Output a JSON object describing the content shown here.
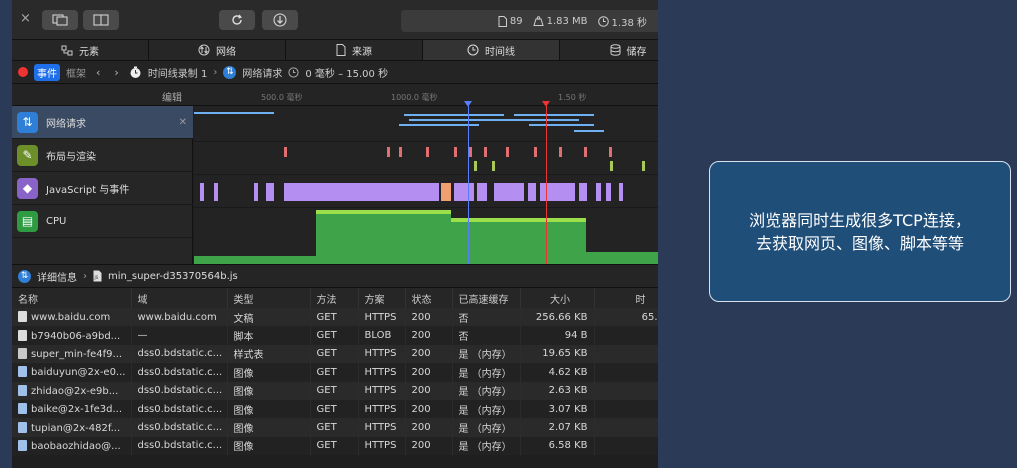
{
  "toolbar": {
    "close": "×",
    "status_resources": "89",
    "status_size": "1.83 MB",
    "status_time": "1.38 秒"
  },
  "tabs": [
    "元素",
    "网络",
    "来源",
    "时间线",
    "储存"
  ],
  "timeline_bar": {
    "events_label": "事件",
    "frames_label": "框架",
    "recording": "时间线录制 1",
    "filter": "网络请求",
    "range": "0 毫秒 – 15.00 秒"
  },
  "ruler": {
    "edit": "编辑",
    "ticks": [
      "500.0 毫秒",
      "1000.0 毫秒",
      "1.50 秒"
    ]
  },
  "tracks": [
    "网络请求",
    "布局与渲染",
    "JavaScript 与事件",
    "CPU"
  ],
  "details": {
    "label": "详细信息",
    "file": "min_super-d35370564b.js"
  },
  "table": {
    "headers": [
      "名称",
      "域",
      "类型",
      "方法",
      "方案",
      "状态",
      "已高速缓存",
      "大小",
      "时"
    ],
    "rows": [
      [
        "www.baidu.com",
        "www.baidu.com",
        "文稿",
        "GET",
        "HTTPS",
        "200",
        "否",
        "256.66 KB",
        "65."
      ],
      [
        "b7940b06-a9bd...",
        "—",
        "脚本",
        "GET",
        "BLOB",
        "200",
        "否",
        "94 B",
        ""
      ],
      [
        "super_min-fe4f9...",
        "dss0.bdstatic.c...",
        "样式表",
        "GET",
        "HTTPS",
        "200",
        "是 （内存）",
        "19.65 KB",
        ""
      ],
      [
        "baiduyun@2x-e0...",
        "dss0.bdstatic.c...",
        "图像",
        "GET",
        "HTTPS",
        "200",
        "是 （内存）",
        "4.62 KB",
        ""
      ],
      [
        "zhidao@2x-e9b...",
        "dss0.bdstatic.c...",
        "图像",
        "GET",
        "HTTPS",
        "200",
        "是 （内存）",
        "2.63 KB",
        ""
      ],
      [
        "baike@2x-1fe3d...",
        "dss0.bdstatic.c...",
        "图像",
        "GET",
        "HTTPS",
        "200",
        "是 （内存）",
        "3.07 KB",
        ""
      ],
      [
        "tupian@2x-482f...",
        "dss0.bdstatic.c...",
        "图像",
        "GET",
        "HTTPS",
        "200",
        "是 （内存）",
        "2.07 KB",
        ""
      ],
      [
        "baobaozhidao@...",
        "dss0.bdstatic.c...",
        "图像",
        "GET",
        "HTTPS",
        "200",
        "是 （内存）",
        "6.58 KB",
        ""
      ]
    ]
  },
  "callout": {
    "line1": "浏览器同时生成很多TCP连接，",
    "line2": "去获取网页、图像、脚本等等"
  }
}
